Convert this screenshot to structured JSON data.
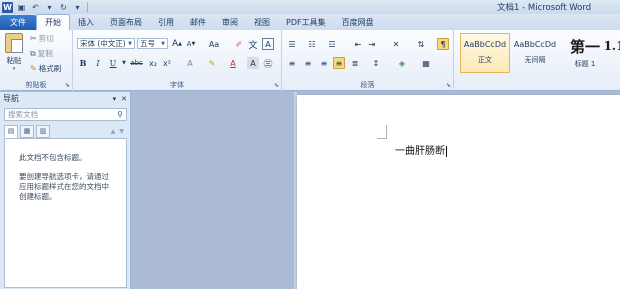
{
  "window": {
    "title": "文档1 - Microsoft Word"
  },
  "tabs": [
    "文件",
    "开始",
    "插入",
    "页面布局",
    "引用",
    "邮件",
    "审阅",
    "视图",
    "PDF工具集",
    "百度网盘"
  ],
  "clipboard": {
    "paste": "粘贴",
    "cut": "剪切",
    "copy": "复制",
    "format_painter": "格式刷",
    "group": "剪贴板"
  },
  "font": {
    "name": "宋体 (中文正)",
    "size": "五号",
    "group": "字体",
    "grow": "A",
    "shrink": "A",
    "case": "Aa",
    "bold": "B",
    "italic": "I",
    "underline": "U",
    "strike": "abc",
    "sub": "x₂",
    "sup": "x²",
    "color_letter": "A",
    "pinyin": "文",
    "char_border": "A"
  },
  "paragraph": {
    "group": "段落"
  },
  "styles": [
    {
      "sample": "AaBbCcDd",
      "name": "正文",
      "selected": true
    },
    {
      "sample": "AaBbCcDd",
      "name": "无间隔",
      "selected": false
    },
    {
      "sample": "第一",
      "name": "标题 1",
      "selected": false
    },
    {
      "sample": "1.1",
      "name": "",
      "selected": false
    }
  ],
  "nav": {
    "title": "导航",
    "search_placeholder": "搜索文档",
    "message1": "此文档不包含标题。",
    "message2": "要创建导航选项卡，请通过应用标题样式在您的文档中创建标题。"
  },
  "document": {
    "text": "一曲肝肠断"
  }
}
